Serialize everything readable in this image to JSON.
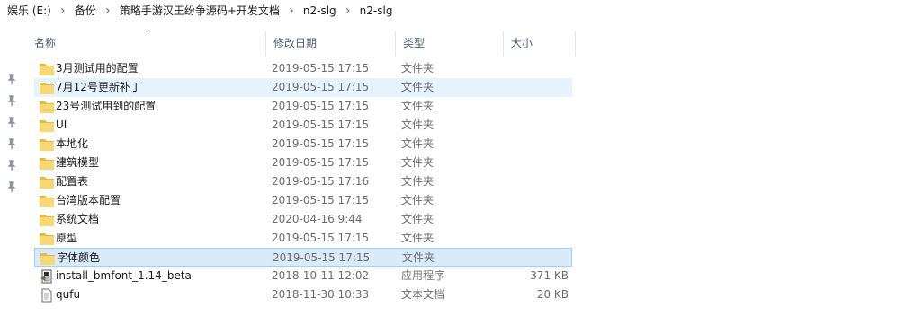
{
  "breadcrumb": [
    "娱乐 (E:)",
    "备份",
    "策略手游汉王纷争源码+开发文档",
    "n2-slg",
    "n2-slg"
  ],
  "columns": {
    "name": "名称",
    "date": "修改日期",
    "type": "类型",
    "size": "大小"
  },
  "files": [
    {
      "name": "3月测试用的配置",
      "date": "2019-05-15 17:15",
      "type": "文件夹",
      "size": "",
      "icon": "folder-icon",
      "state": ""
    },
    {
      "name": "7月12号更新补丁",
      "date": "2019-05-15 17:15",
      "type": "文件夹",
      "size": "",
      "icon": "folder-icon",
      "state": "hover"
    },
    {
      "name": "23号测试用到的配置",
      "date": "2019-05-15 17:15",
      "type": "文件夹",
      "size": "",
      "icon": "folder-icon",
      "state": ""
    },
    {
      "name": "UI",
      "date": "2019-05-15 17:15",
      "type": "文件夹",
      "size": "",
      "icon": "folder-icon",
      "state": ""
    },
    {
      "name": "本地化",
      "date": "2019-05-15 17:15",
      "type": "文件夹",
      "size": "",
      "icon": "folder-icon",
      "state": ""
    },
    {
      "name": "建筑模型",
      "date": "2019-05-15 17:15",
      "type": "文件夹",
      "size": "",
      "icon": "folder-icon",
      "state": ""
    },
    {
      "name": "配置表",
      "date": "2019-05-15 17:16",
      "type": "文件夹",
      "size": "",
      "icon": "folder-icon",
      "state": ""
    },
    {
      "name": "台湾版本配置",
      "date": "2019-05-15 17:15",
      "type": "文件夹",
      "size": "",
      "icon": "folder-icon",
      "state": ""
    },
    {
      "name": "系统文档",
      "date": "2020-04-16 9:44",
      "type": "文件夹",
      "size": "",
      "icon": "folder-icon",
      "state": ""
    },
    {
      "name": "原型",
      "date": "2019-05-15 17:15",
      "type": "文件夹",
      "size": "",
      "icon": "folder-icon",
      "state": ""
    },
    {
      "name": "字体颜色",
      "date": "2019-05-15 17:15",
      "type": "文件夹",
      "size": "",
      "icon": "folder-icon",
      "state": "sel"
    },
    {
      "name": "install_bmfont_1.14_beta",
      "date": "2018-10-11 12:02",
      "type": "应用程序",
      "size": "371 KB",
      "icon": "installer-icon",
      "state": ""
    },
    {
      "name": "qufu",
      "date": "2018-11-30 10:33",
      "type": "文本文档",
      "size": "20 KB",
      "icon": "text-file-icon",
      "state": ""
    }
  ],
  "colors": {
    "folder": "#f8d775",
    "folder_dark": "#e8b93c",
    "selected_bg": "#d9ebf9",
    "selected_border": "#99d1ff",
    "hover_bg": "#e5f3ff",
    "header_text": "#4c607a"
  }
}
